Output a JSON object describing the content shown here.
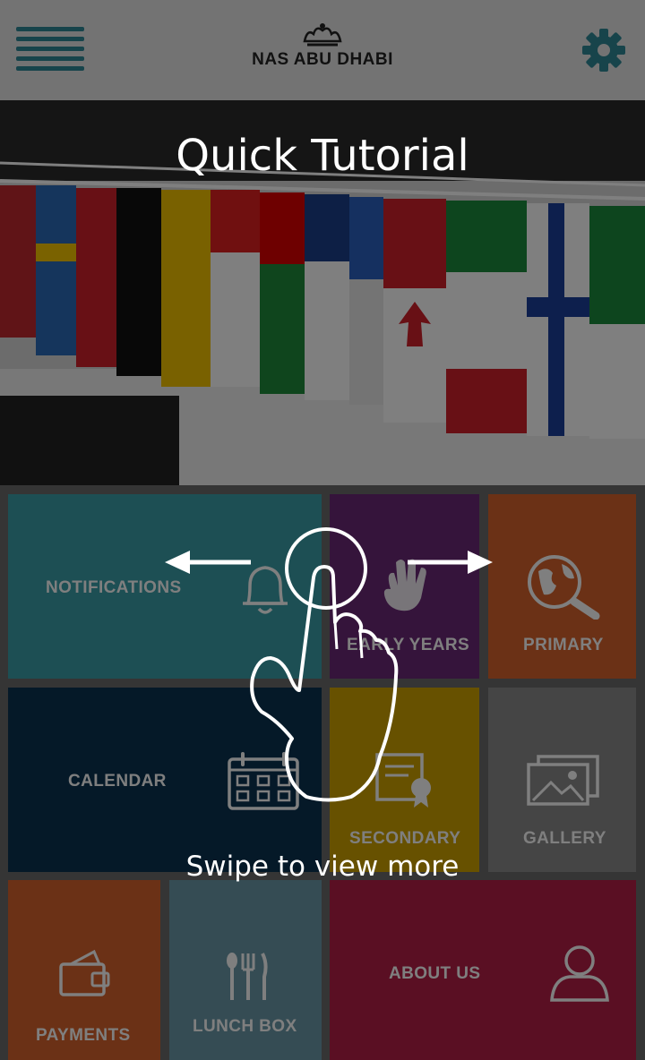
{
  "app": {
    "title": "NAS ABU DHABI",
    "colors": {
      "accent": "#2f8896",
      "header_bg": "#e6e6e6"
    }
  },
  "header": {
    "menu_icon": "hamburger-icon",
    "settings_icon": "gear-icon"
  },
  "tutorial": {
    "title": "Quick Tutorial",
    "hint": "Swipe to view more",
    "gesture_icon": "swipe-hand-icon"
  },
  "tiles": [
    {
      "label": "NOTIFICATIONS",
      "icon": "bell-icon",
      "color": "#3a9fa8"
    },
    {
      "label": "EARLY YEARS",
      "icon": "handprint-icon",
      "color": "#6a2877"
    },
    {
      "label": "PRIMARY",
      "icon": "globe-search-icon",
      "color": "#d7632d"
    },
    {
      "label": "CALENDAR",
      "icon": "calendar-icon",
      "color": "#0a3350"
    },
    {
      "label": "SECONDARY",
      "icon": "certificate-icon",
      "color": "#cfa200"
    },
    {
      "label": "GALLERY",
      "icon": "gallery-icon",
      "color": "#8a8a8a"
    },
    {
      "label": "PAYMENTS",
      "icon": "wallet-icon",
      "color": "#d7632d"
    },
    {
      "label": "LUNCH BOX",
      "icon": "cutlery-icon",
      "color": "#6b99a8"
    },
    {
      "label": "ABOUT US",
      "icon": "user-icon",
      "color": "#b41f46"
    }
  ]
}
